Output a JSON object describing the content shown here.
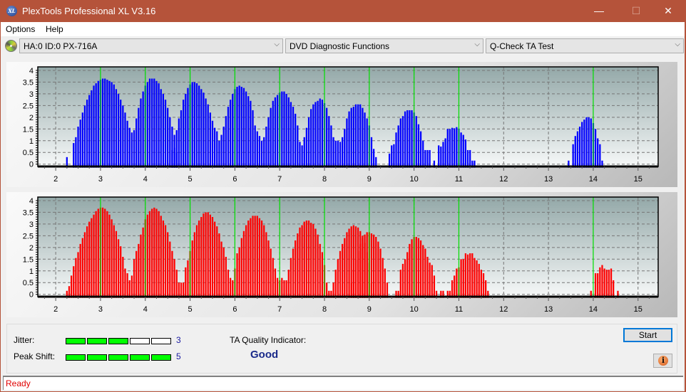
{
  "window": {
    "title": "PlexTools Professional XL V3.16",
    "logo_text": "XL",
    "minimize_glyph": "—",
    "maximize_glyph": "☐",
    "close_glyph": "✕"
  },
  "menu": [
    "Options",
    "Help"
  ],
  "toolbar": {
    "drive": "HA:0 ID:0  PX-716A",
    "function": "DVD Diagnostic Functions",
    "test": "Q-Check TA Test",
    "arrow_glyph": "⌵"
  },
  "chart_data": [
    {
      "type": "bar",
      "name": "ta-test-upper",
      "color": "#0000ff",
      "title": "",
      "xlabel": "",
      "ylabel": "",
      "xlim": [
        1.6,
        15.45
      ],
      "ylim": [
        -0.1,
        4.15
      ],
      "xticks": [
        2,
        3,
        4,
        5,
        6,
        7,
        8,
        9,
        10,
        11,
        12,
        13,
        14,
        15
      ],
      "yticks": [
        0,
        0.5,
        1,
        1.5,
        2,
        2.5,
        3,
        3.5,
        4
      ],
      "ytick_labels": [
        "0",
        "0.5",
        "1",
        "1.5",
        "2",
        "2.5",
        "3",
        "3.5",
        "4"
      ],
      "grid": true,
      "reference_lines": [
        3,
        4,
        5,
        6,
        7,
        8,
        9,
        10,
        11,
        14
      ],
      "bar_step": 0.05,
      "segments": [
        {
          "x0": 2.25,
          "values": [
            0.3
          ]
        },
        {
          "x0": 2.4,
          "values": [
            0.9,
            1.15,
            1.6,
            1.9,
            2.2,
            2.5,
            2.75,
            2.95,
            3.15,
            3.35,
            3.45,
            3.55,
            3.6,
            3.65,
            3.65,
            3.6,
            3.55,
            3.5,
            3.4,
            3.2,
            3.0,
            2.75,
            2.5,
            2.2,
            1.85,
            1.55,
            1.35,
            1.45,
            1.95,
            2.4,
            2.8,
            3.1,
            3.35,
            3.5,
            3.65,
            3.65,
            3.65,
            3.55,
            3.45,
            3.2,
            3.0,
            2.75,
            2.4,
            2.0,
            1.6,
            1.25,
            0.5
          ]
        },
        {
          "x0": 4.6,
          "values": [
            0.6,
            0.7,
            1.45,
            1.95,
            2.3,
            2.75,
            3.0,
            3.25,
            3.4,
            3.5,
            3.5,
            3.45,
            3.35,
            3.2,
            3.05,
            2.8,
            2.55,
            2.2,
            1.85,
            1.55,
            1.4,
            1.0,
            1.25,
            1.6,
            2.05,
            2.45,
            2.75,
            3.0,
            3.2,
            3.3,
            3.35,
            3.3,
            3.25,
            3.1,
            2.9,
            2.7,
            2.3,
            1.65,
            1.4,
            1.2,
            1.0,
            1.15,
            1.6,
            2.0,
            2.4,
            2.7,
            2.85,
            2.95,
            3.05,
            3.1,
            3.1,
            3.0,
            2.85,
            2.65,
            2.45,
            2.15,
            1.65,
            0.95,
            0.8,
            1.15,
            1.55,
            2.0,
            2.35,
            2.55,
            2.65,
            2.7,
            2.8,
            2.75,
            2.6,
            2.4,
            2.05,
            1.65,
            1.15,
            1.0,
            1.0,
            0.95,
            1.15,
            1.5,
            1.95,
            2.25,
            2.4,
            2.45,
            2.55,
            2.55,
            2.55,
            2.4,
            2.2,
            1.95,
            1.65,
            1.15,
            0.65,
            0.3
          ]
        },
        {
          "x0": 9.45,
          "values": [
            0.45,
            0.8,
            0.85,
            1.35,
            1.65,
            1.95,
            2.05,
            2.25,
            2.3,
            2.3,
            2.3,
            2.2,
            2.05,
            1.7,
            1.4,
            1.0,
            0.6,
            0.6,
            0.6
          ]
        },
        {
          "x0": 10.45,
          "values": [
            0.15
          ]
        },
        {
          "x0": 10.55,
          "values": [
            0.8,
            0.75,
            0.95,
            1.1,
            1.5,
            1.5,
            1.55,
            1.53,
            1.58,
            1.5,
            1.35,
            1.25,
            1.05,
            0.6,
            0.6,
            0.15,
            0.15
          ]
        },
        {
          "x0": 13.45,
          "values": [
            0.15,
            0.0,
            0.85,
            1.2,
            1.4,
            1.6,
            1.8,
            1.9,
            2.0,
            2.0,
            1.95,
            1.75,
            1.5,
            1.1,
            0.85,
            0.15
          ]
        }
      ]
    },
    {
      "type": "bar",
      "name": "ta-test-lower",
      "color": "#ff0000",
      "title": "",
      "xlabel": "",
      "ylabel": "",
      "xlim": [
        1.6,
        15.45
      ],
      "ylim": [
        -0.1,
        4.15
      ],
      "xticks": [
        2,
        3,
        4,
        5,
        6,
        7,
        8,
        9,
        10,
        11,
        12,
        13,
        14,
        15
      ],
      "yticks": [
        0,
        0.5,
        1,
        1.5,
        2,
        2.5,
        3,
        3.5,
        4
      ],
      "ytick_labels": [
        "0",
        "0.5",
        "1",
        "1.5",
        "2",
        "2.5",
        "3",
        "3.5",
        "4"
      ],
      "grid": true,
      "reference_lines": [
        3,
        4,
        5,
        6,
        7,
        8,
        9,
        10,
        11,
        14
      ],
      "bar_step": 0.05,
      "segments": [
        {
          "x0": 2.25,
          "values": [
            0.15,
            0.35,
            0.8,
            1.2,
            1.55,
            1.8,
            2.15,
            2.4,
            2.65,
            2.9,
            3.1,
            3.25,
            3.4,
            3.55,
            3.65,
            3.7,
            3.7,
            3.65,
            3.55,
            3.4,
            3.2,
            2.95,
            2.7,
            2.35,
            2.05,
            1.6,
            1.1,
            0.9,
            0.6,
            0.8,
            1.5,
            1.85,
            2.15,
            2.55,
            2.85,
            3.2,
            3.4,
            3.55,
            3.65,
            3.7,
            3.65,
            3.55,
            3.35,
            3.15,
            2.95,
            2.65,
            2.25,
            1.85,
            1.5,
            1.05,
            0.5,
            0.5,
            0.5,
            1.15,
            1.45,
            1.85,
            2.3,
            2.65,
            2.95,
            3.15,
            3.3,
            3.45,
            3.5,
            3.5,
            3.4,
            3.3,
            3.1,
            2.9,
            2.6,
            2.25,
            2.0,
            1.6,
            1.05,
            0.7,
            0.6,
            1.1,
            1.75,
            2.0,
            2.4,
            2.7,
            2.95,
            3.15,
            3.25,
            3.35,
            3.35,
            3.35,
            3.25,
            3.15,
            2.95,
            2.65,
            2.3,
            1.95,
            1.55,
            1.1,
            0.7,
            0.6,
            0.7,
            0.6,
            0.6,
            1.05,
            1.55,
            1.95,
            2.3,
            2.6,
            2.85,
            2.95,
            3.1,
            3.15,
            3.15,
            3.05,
            3.0,
            2.8,
            2.55,
            2.15,
            1.8,
            1.25,
            0.5,
            0.15,
            0.15,
            0.5,
            1.05,
            1.5,
            1.85,
            2.15,
            2.4,
            2.65,
            2.8,
            2.9,
            2.95,
            2.9,
            2.85,
            2.7,
            2.5,
            2.2,
            1.8,
            1.35,
            0.5
          ]
        },
        {
          "x0": 8.6,
          "values": [
            0.5,
            1.05,
            1.5,
            1.85,
            2.15,
            2.4,
            2.55,
            2.65,
            2.65,
            2.6,
            2.55,
            2.45,
            2.25,
            1.95,
            1.55,
            1.1,
            0.5
          ]
        },
        {
          "x0": 9.6,
          "values": [
            0.15,
            0.15,
            1.05,
            1.3,
            1.5,
            1.8,
            2.15,
            2.35,
            2.45,
            2.45,
            2.4,
            2.3,
            2.1,
            1.95,
            1.6,
            1.35,
            1.25,
            0.8,
            0.15
          ]
        },
        {
          "x0": 10.6,
          "values": [
            0.15,
            0.15,
            0.0,
            0.15,
            0.15,
            0.6,
            0.8,
            1.1,
            1.15,
            1.5,
            1.5,
            1.75,
            1.7,
            1.75,
            1.75,
            1.55,
            1.45,
            1.3,
            1.05,
            0.9,
            0.6,
            0.15
          ]
        },
        {
          "x0": 13.95,
          "values": [
            0.15,
            0.0,
            0.9,
            0.9,
            1.15,
            1.25,
            1.1,
            1.05,
            1.05,
            1.1,
            0.6,
            0.0,
            0.15
          ]
        }
      ]
    }
  ],
  "results": {
    "jitter_label": "Jitter:",
    "jitter_value": "3",
    "jitter_level": 3,
    "peak_shift_label": "Peak Shift:",
    "peak_shift_value": "5",
    "peak_shift_level": 5,
    "segments_total": 5,
    "ta_quality_label": "TA Quality Indicator:",
    "ta_quality_value": "Good"
  },
  "buttons": {
    "start": "Start",
    "info_glyph": "i"
  },
  "status": "Ready"
}
